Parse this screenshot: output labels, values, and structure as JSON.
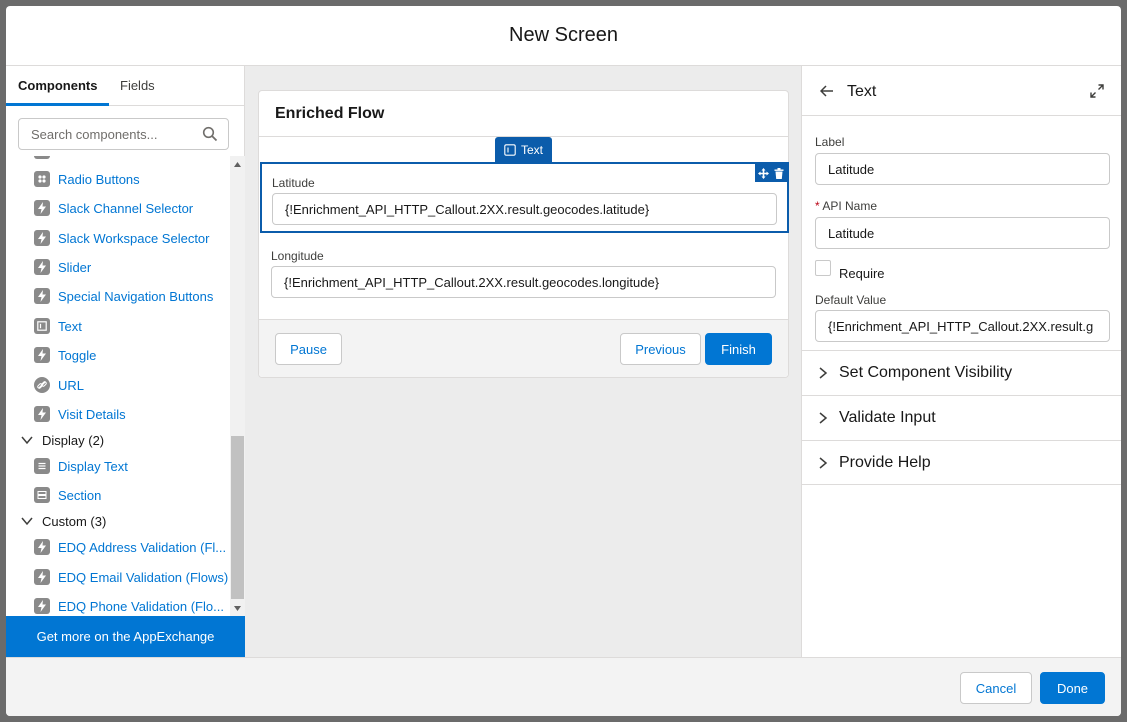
{
  "modal": {
    "title": "New Screen"
  },
  "left": {
    "tabs": [
      {
        "label": "Components"
      },
      {
        "label": "Fields"
      }
    ],
    "search_placeholder": "Search components...",
    "items": [
      {
        "label": "Radio Buttons",
        "icon": "radio-icon"
      },
      {
        "label": "Slack Channel Selector",
        "icon": "lightning-icon"
      },
      {
        "label": "Slack Workspace Selector",
        "icon": "lightning-icon"
      },
      {
        "label": "Slider",
        "icon": "lightning-icon"
      },
      {
        "label": "Special Navigation Buttons",
        "icon": "lightning-icon"
      },
      {
        "label": "Text",
        "icon": "text-field-icon"
      },
      {
        "label": "Toggle",
        "icon": "lightning-icon"
      },
      {
        "label": "URL",
        "icon": "link-icon"
      },
      {
        "label": "Visit Details",
        "icon": "lightning-icon"
      }
    ],
    "group_display": "Display (2)",
    "display_items": [
      {
        "label": "Display Text",
        "icon": "display-text-icon"
      },
      {
        "label": "Section",
        "icon": "section-icon"
      }
    ],
    "group_custom": "Custom (3)",
    "custom_items": [
      {
        "label": "EDQ Address Validation (Fl...",
        "icon": "lightning-icon"
      },
      {
        "label": "EDQ Email Validation (Flows)",
        "icon": "lightning-icon"
      },
      {
        "label": "EDQ Phone Validation (Flo...",
        "icon": "lightning-icon"
      }
    ],
    "appexchange": "Get more on the AppExchange"
  },
  "canvas": {
    "title": "Enriched Flow",
    "chip_label": "Text",
    "fields": [
      {
        "label": "Latitude",
        "value": "{!Enrichment_API_HTTP_Callout.2XX.result.geocodes.latitude}"
      },
      {
        "label": "Longitude",
        "value": "{!Enrichment_API_HTTP_Callout.2XX.result.geocodes.longitude}"
      }
    ],
    "pause": "Pause",
    "previous": "Previous",
    "finish": "Finish"
  },
  "right": {
    "title": "Text",
    "label_label": "Label",
    "label_value": "Latitude",
    "api_required": "*",
    "api_label": "API Name",
    "api_value": "Latitude",
    "require_label": "Require",
    "default_label": "Default Value",
    "default_value": "{!Enrichment_API_HTTP_Callout.2XX.result.g",
    "sections": [
      {
        "label": "Set Component Visibility"
      },
      {
        "label": "Validate Input"
      },
      {
        "label": "Provide Help"
      }
    ]
  },
  "footer": {
    "cancel": "Cancel",
    "done": "Done"
  },
  "colors": {
    "brand": "#0176d3",
    "selection": "#0b5cab",
    "backdrop": "#6b6b6b"
  }
}
